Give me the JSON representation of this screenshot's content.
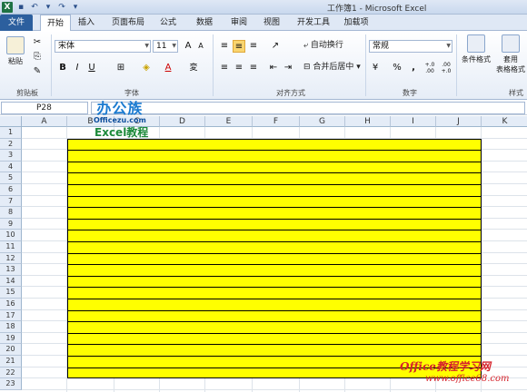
{
  "window": {
    "title": "工作簿1 - Microsoft Excel"
  },
  "tabs": [
    "文件",
    "开始",
    "插入",
    "页面布局",
    "公式",
    "数据",
    "审阅",
    "视图",
    "开发工具",
    "加载项"
  ],
  "ribbon": {
    "clipboard": {
      "paste": "粘贴",
      "label": "剪贴板"
    },
    "font": {
      "name": "宋体",
      "size": "11",
      "label": "字体",
      "bold": "B",
      "italic": "I",
      "underline": "U",
      "grow": "A",
      "shrink": "A",
      "wen": "wén",
      "phonetic": "変"
    },
    "alignment": {
      "wrap": "自动换行",
      "merge": "合并后居中",
      "label": "对齐方式"
    },
    "number": {
      "format": "常规",
      "percent": "%",
      "comma": ",",
      "inc": "+.0 .00",
      "dec": ".00 +.0",
      "label": "数字"
    },
    "styles": {
      "conditional": "条件格式",
      "table1": "套用",
      "table2": "表格格式",
      "label": "样式"
    }
  },
  "formula_bar": {
    "name_box": "P28",
    "formula": ""
  },
  "sheet": {
    "columns": [
      "A",
      "B",
      "C",
      "D",
      "E",
      "F",
      "G",
      "H",
      "I",
      "J",
      "K"
    ],
    "rows": [
      "1",
      "2",
      "3",
      "4",
      "5",
      "6",
      "7",
      "8",
      "9",
      "10",
      "11",
      "12",
      "13",
      "14",
      "15",
      "16",
      "17",
      "18",
      "19",
      "20",
      "21",
      "22",
      "23"
    ],
    "fill_color": "#ffff00",
    "line_color": "#000000"
  },
  "watermarks": {
    "logo": "办公族",
    "logo_sub": "Officezu.com",
    "excel_tutorial": "Excel教程",
    "site_name": "Office教程学习网",
    "site_url": "www.office68.com"
  }
}
